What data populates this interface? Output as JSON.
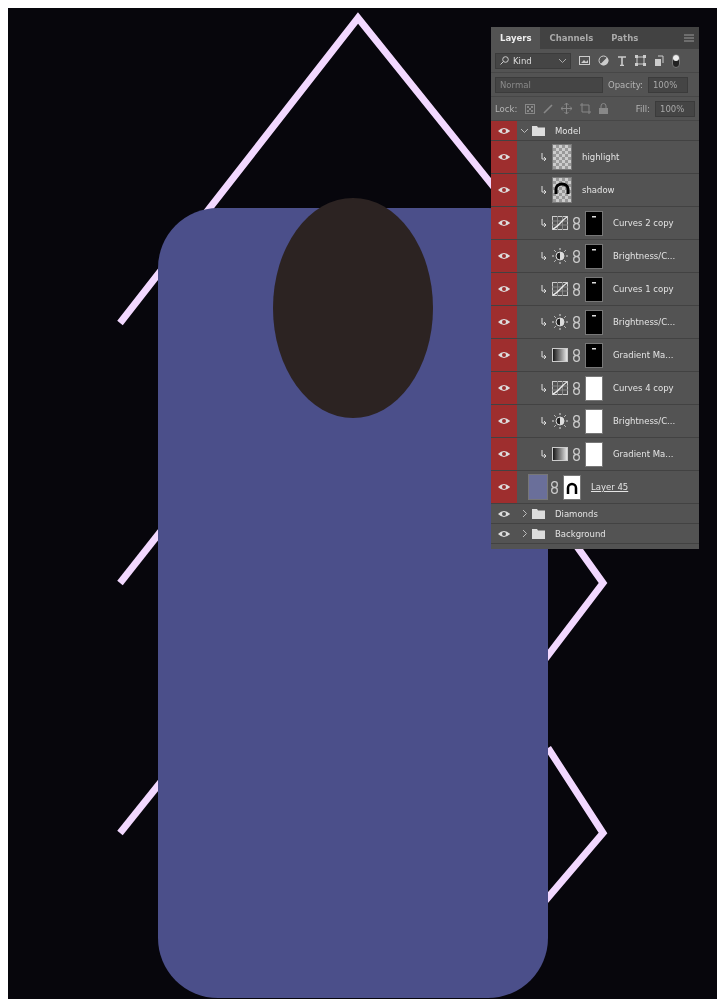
{
  "tabs": [
    {
      "label": "Layers",
      "selected": true
    },
    {
      "label": "Channels",
      "selected": false
    },
    {
      "label": "Paths",
      "selected": false
    }
  ],
  "filter": {
    "value": "Kind"
  },
  "blend": {
    "value": "Normal",
    "disabled": true
  },
  "opacity": {
    "label": "Opacity:",
    "value": "100%"
  },
  "lock": {
    "label": "Lock:"
  },
  "fill": {
    "label": "Fill:",
    "value": "100%"
  },
  "layers": [
    {
      "kind": "group",
      "name": "Model",
      "color": "#9e2e2e",
      "expanded": true,
      "children": [
        {
          "kind": "pixel",
          "name": "highlight",
          "clipped": true,
          "thumb_shape": false
        },
        {
          "kind": "pixel",
          "name": "shadow",
          "clipped": true,
          "thumb_shape": true
        },
        {
          "kind": "curves",
          "name": "Curves 2 copy",
          "clipped": true,
          "mask_dark": true
        },
        {
          "kind": "brightness",
          "name": "Brightness/C...",
          "clipped": true,
          "mask_dark": true
        },
        {
          "kind": "curves",
          "name": "Curves 1 copy",
          "clipped": true,
          "mask_dark": true
        },
        {
          "kind": "brightness",
          "name": "Brightness/C...",
          "clipped": true,
          "mask_dark": true
        },
        {
          "kind": "gradient",
          "name": "Gradient Ma...",
          "clipped": true,
          "mask_dark": true
        },
        {
          "kind": "curves",
          "name": "Curves 4 copy",
          "clipped": true,
          "mask_dark": false
        },
        {
          "kind": "brightness",
          "name": "Brightness/C...",
          "clipped": true,
          "mask_dark": false
        },
        {
          "kind": "gradient",
          "name": "Gradient Ma...",
          "clipped": true,
          "mask_dark": false
        },
        {
          "kind": "masked",
          "name": "Layer 45",
          "clipped": false,
          "underlined": true,
          "mask_dark": false,
          "mask_shape": true
        }
      ]
    },
    {
      "kind": "group",
      "name": "Diamonds",
      "expanded": false
    },
    {
      "kind": "group",
      "name": "Background",
      "expanded": false
    }
  ]
}
